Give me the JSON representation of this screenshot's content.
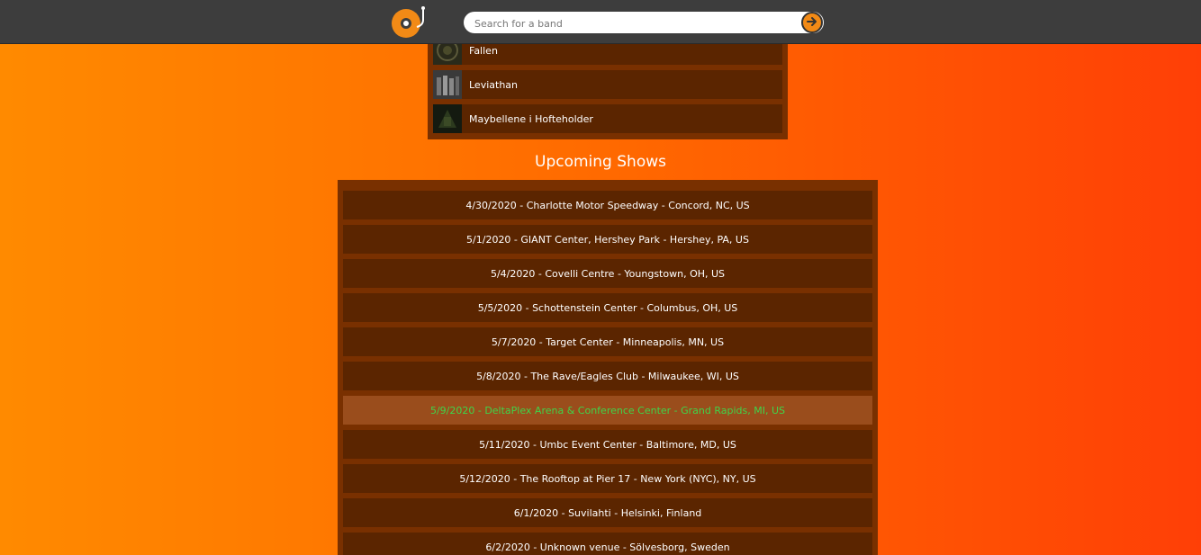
{
  "header": {
    "logo": "turntable-logo-icon",
    "search": {
      "placeholder": "Search for a band",
      "value": ""
    },
    "search_button_icon": "arrow-right-icon"
  },
  "albums": [
    {
      "title": "Fallen"
    },
    {
      "title": "Leviathan"
    },
    {
      "title": "Maybellene i Hofteholder"
    }
  ],
  "upcoming": {
    "title": "Upcoming Shows",
    "shows": [
      {
        "text": "4/30/2020 - Charlotte Motor Speedway - Concord, NC, US",
        "highlighted": false
      },
      {
        "text": "5/1/2020 - GIANT Center, Hershey Park - Hershey, PA, US",
        "highlighted": false
      },
      {
        "text": "5/4/2020 - Covelli Centre - Youngstown, OH, US",
        "highlighted": false
      },
      {
        "text": "5/5/2020 - Schottenstein Center - Columbus, OH, US",
        "highlighted": false
      },
      {
        "text": "5/7/2020 - Target Center - Minneapolis, MN, US",
        "highlighted": false
      },
      {
        "text": "5/8/2020 - The Rave/Eagles Club - Milwaukee, WI, US",
        "highlighted": false
      },
      {
        "text": "5/9/2020 - DeltaPlex Arena & Conference Center - Grand Rapids, MI, US",
        "highlighted": true
      },
      {
        "text": "5/11/2020 - Umbc Event Center - Baltimore, MD, US",
        "highlighted": false
      },
      {
        "text": "5/12/2020 - The Rooftop at Pier 17 - New York (NYC), NY, US",
        "highlighted": false
      },
      {
        "text": "6/1/2020 - Suvilahti - Helsinki, Finland",
        "highlighted": false
      },
      {
        "text": "6/2/2020 - Unknown venue - Sölvesborg, Sweden",
        "highlighted": false
      }
    ]
  },
  "colors": {
    "accent": "#f28a16",
    "highlight_text": "#3fd44a"
  }
}
